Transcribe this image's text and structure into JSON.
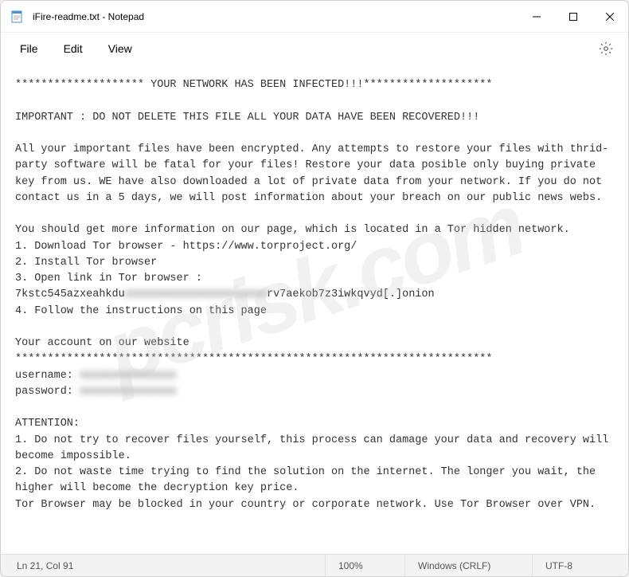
{
  "titlebar": {
    "title": "iFire-readme.txt - Notepad"
  },
  "menubar": {
    "file": "File",
    "edit": "Edit",
    "view": "View"
  },
  "content": {
    "line1": "******************** YOUR NETWORK HAS BEEN INFECTED!!!********************",
    "line2": "",
    "line3": "IMPORTANT : DO NOT DELETE THIS FILE ALL YOUR DATA HAVE BEEN RECOVERED!!!",
    "line4": "",
    "line5": "All your important files have been encrypted. Any attempts to restore your files with thrid-party software will be fatal for your files! Restore your data posible only buying private key from us. WE have also downloaded a lot of private data from your network. If you do not contact us in a 5 days, we will post information about your breach on our public news webs.",
    "line6": "",
    "line7": "You should get more information on our page, which is located in a Tor hidden network.",
    "line8": "1. Download Tor browser - https://www.torproject.org/",
    "line9": "2. Install Tor browser",
    "line10": "3. Open link in Tor browser :",
    "line11a": "7kstc545azxeahkdu",
    "line11b": "xxxxxxxxxxxxxxxxxxxxxx",
    "line11c": "rv7aekob7z3iwkqvyd[.]onion",
    "line12": "4. Follow the instructions on this page",
    "line13": "",
    "line14": "Your account on our website",
    "line15": "**************************************************************************",
    "line16a": "username: ",
    "line16b": "xxxxxxxxxxxxxxx",
    "line17a": "password: ",
    "line17b": "xxxxxxxxxxxxxxx",
    "line18": "",
    "line19": "ATTENTION:",
    "line20": "1. Do not try to recover files yourself, this process can damage your data and recovery will become impossible.",
    "line21": "2. Do not waste time trying to find the solution on the internet. The longer you wait, the higher will become the decryption key price.",
    "line22": "Tor Browser may be blocked in your country or corporate network. Use Tor Browser over VPN."
  },
  "statusbar": {
    "position": "Ln 21, Col 91",
    "zoom": "100%",
    "encoding": "Windows (CRLF)",
    "charset": "UTF-8"
  },
  "watermark": "pcrisk.com"
}
